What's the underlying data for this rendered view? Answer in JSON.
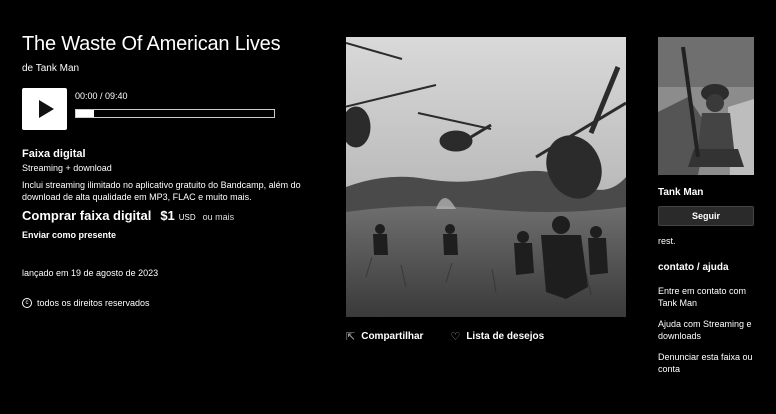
{
  "track": {
    "title": "The Waste Of American Lives",
    "by_prefix": "de",
    "artist": "Tank Man"
  },
  "player": {
    "time": "00:00 / 09:40",
    "progress": 0.09
  },
  "digital": {
    "heading": "Faixa digital",
    "sub": "Streaming + download",
    "description": "Inclui streaming ilimitado no aplicativo gratuito do Bandcamp, além do download de alta qualidade em MP3, FLAC e muito mais.",
    "buy_label": "Comprar faixa digital",
    "price": "$1",
    "currency": "USD",
    "or_more": "ou mais",
    "gift": "Enviar como presente"
  },
  "released": "lançado em 19 de agosto de 2023",
  "rights": "todos os direitos reservados",
  "actions": {
    "share": "Compartilhar",
    "wishlist": "Lista de desejos"
  },
  "sidebar": {
    "artist_name": "Tank Man",
    "follow": "Seguir",
    "location": "rest.",
    "contact_heading": "contato / ajuda",
    "links": [
      "Entre em contato com Tank Man",
      "Ajuda com Streaming e downloads",
      "Denunciar esta faixa ou conta"
    ]
  },
  "icons": {
    "play": "play-icon",
    "share": "share-icon",
    "wishlist": "heart-icon",
    "rights": "copyright-icon"
  }
}
